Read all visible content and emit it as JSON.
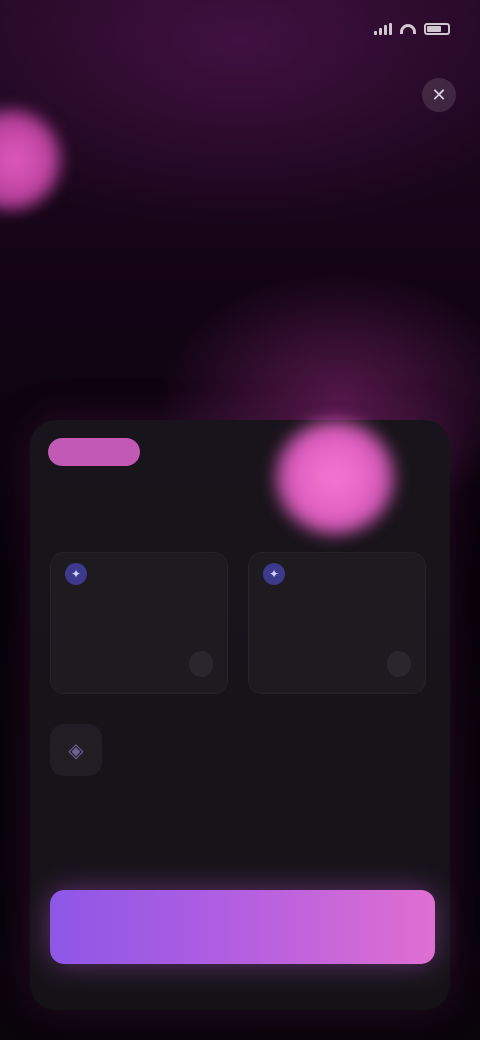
{
  "status_bar": {
    "time": "",
    "network": ""
  },
  "hero": {
    "eyebrow": "",
    "headline": "",
    "subtitle": ""
  },
  "card": {
    "badge": "",
    "title": "",
    "plans": [
      {
        "line1": "",
        "line2": "",
        "price": ""
      },
      {
        "line1": "",
        "line2": "",
        "price": ""
      }
    ],
    "feature": "",
    "link": ""
  },
  "cta": {
    "label": ""
  },
  "colors": {
    "accent_pink": "#dd5cbf",
    "accent_purple": "#8d57e6",
    "background": "#070208",
    "card": "#19141b"
  },
  "icons": [
    "signal-icon",
    "wifi-icon",
    "battery-icon",
    "close-icon",
    "plan-icon",
    "feature-icon"
  ]
}
